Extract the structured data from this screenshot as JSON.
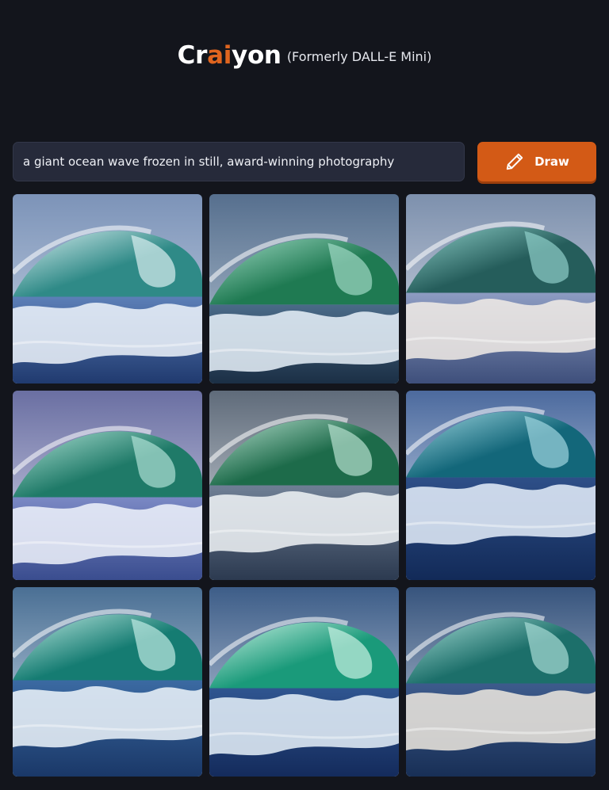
{
  "header": {
    "logo_prefix": "Cr",
    "logo_accent": "ai",
    "logo_suffix": "yon",
    "tagline": "(Formerly DALL-E Mini)"
  },
  "prompt": {
    "value": "a giant ocean wave frozen in still, award-winning photography"
  },
  "draw_button": {
    "label": "Draw",
    "icon": "pencil-icon"
  },
  "colors": {
    "background": "#13151c",
    "accent": "#d35a16",
    "input_background": "#262a3a"
  },
  "results": {
    "images": [
      {
        "name": "generated-image-1"
      },
      {
        "name": "generated-image-2"
      },
      {
        "name": "generated-image-3"
      },
      {
        "name": "generated-image-4"
      },
      {
        "name": "generated-image-5"
      },
      {
        "name": "generated-image-6"
      },
      {
        "name": "generated-image-7"
      },
      {
        "name": "generated-image-8"
      },
      {
        "name": "generated-image-9"
      }
    ]
  }
}
